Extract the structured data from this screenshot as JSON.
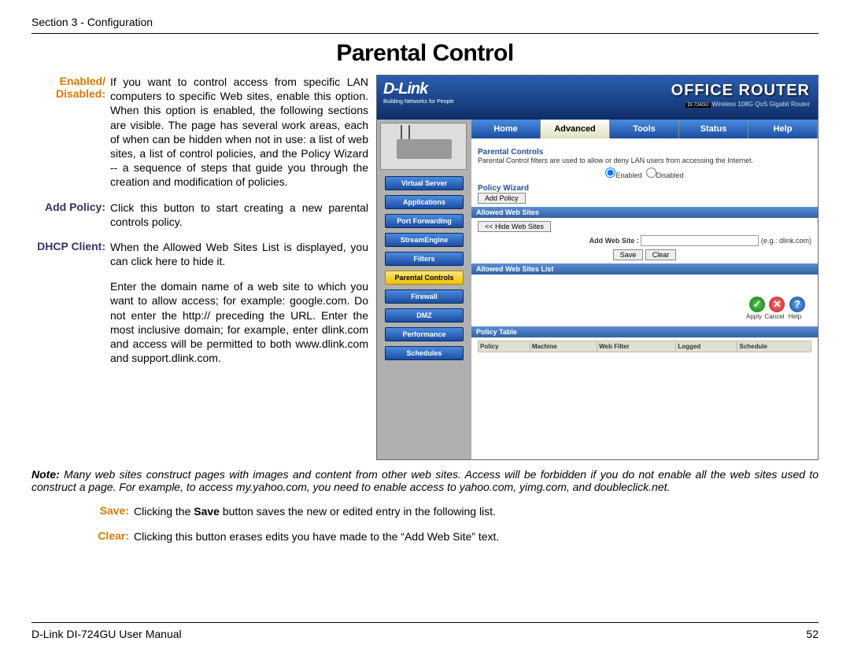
{
  "header": {
    "section": "Section 3 - Configuration"
  },
  "title": "Parental Control",
  "defs": {
    "enabled": {
      "label": "Enabled/ Disabled:",
      "text": "If you want to control access from specific LAN computers to specific Web sites, enable this option. When this option is enabled, the following sections are visible. The page has several work areas, each of when can be hidden when not in use: a list of web sites, a list of control policies, and the Policy Wizard -- a sequence of steps that guide you through the creation and modification of policies."
    },
    "addpolicy": {
      "label": "Add Policy:",
      "text": "Click this button to start creating a new parental controls policy."
    },
    "dhcp": {
      "label": "DHCP Client:",
      "text": "When the Allowed Web Sites List is displayed, you can click here to hide it."
    },
    "domain": {
      "text": "Enter the domain name of a web site to which you want to allow access; for example: google.com. Do not enter the http:// preceding the URL. Enter the most inclusive domain; for example, enter dlink.com and access will be permitted to both www.dlink.com and support.dlink.com."
    },
    "note": "Note: Many web sites construct pages with images and content from other web sites. Access will be forbidden if you do not enable all the web sites used to construct a page. For example, to access my.yahoo.com, you need to enable access to yahoo.com, yimg.com, and doubleclick.net.",
    "save": {
      "label": "Save:",
      "text_pre": "Clicking the ",
      "text_bold": "Save",
      "text_post": " button saves the new or edited entry in the following list."
    },
    "clear": {
      "label": "Clear:",
      "text": "Clicking this button erases edits you have made to the “Add Web Site” text."
    }
  },
  "screenshot": {
    "logo": "D-Link",
    "logo_sub": "Building Networks for People",
    "office_router": "OFFICE ROUTER",
    "model": "DI-724GU",
    "model_desc": "Wireless 108G QoS Gigabit Router",
    "tabs": [
      "Home",
      "Advanced",
      "Tools",
      "Status",
      "Help"
    ],
    "active_tab": 1,
    "side": [
      "Virtual Server",
      "Applications",
      "Port Forwarding",
      "StreamEngine",
      "Filters",
      "Parental Controls",
      "Firewall",
      "DMZ",
      "Performance",
      "Schedules"
    ],
    "active_side": 5,
    "pc_title": "Parental Controls",
    "pc_desc": "Parental Control filters are used to allow or deny LAN users from accessing the Internet.",
    "enabled": "Enabled",
    "disabled": "Disabled",
    "policy_wizard": "Policy Wizard",
    "add_policy": "Add Policy",
    "allowed_sites": "Allowed Web Sites",
    "hide_sites": "<< Hide Web Sites",
    "add_web_site": "Add Web Site :",
    "eg": "(e.g.: dlink.com)",
    "save": "Save",
    "clear": "Clear",
    "allowed_list": "Allowed Web Sites List",
    "apply": "Apply",
    "cancel": "Cancel",
    "help": "Help",
    "policy_table": "Policy Table",
    "cols": [
      "Policy",
      "Machine",
      "Web Filter",
      "Logged",
      "Schedule"
    ]
  },
  "footer": {
    "manual": "D-Link DI-724GU User Manual",
    "page": "52"
  }
}
